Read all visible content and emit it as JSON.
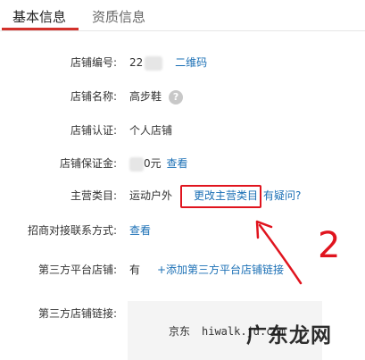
{
  "tabs": [
    {
      "label": "基本信息",
      "active": true
    },
    {
      "label": "资质信息",
      "active": false
    }
  ],
  "store": {
    "id_label": "店铺编号:",
    "id_prefix": "22",
    "qrcode_link": "二维码",
    "name_label": "店铺名称:",
    "name_value": "高步鞋",
    "cert_label": "店铺认证:",
    "cert_value": "个人店铺",
    "deposit_label": "店铺保证金:",
    "deposit_suffix": "0元",
    "deposit_view": "查看",
    "category_label": "主营类目:",
    "category_value": "运动户外",
    "change_category": "更改主营类目",
    "question_link": "有疑问?",
    "contact_label": "招商对接联系方式:",
    "contact_view": "查看",
    "third_platform_label": "第三方平台店铺:",
    "third_platform_value": "有",
    "add_third_platform": "+添加第三方平台店铺链接",
    "third_link_label": "第三方店铺链接:",
    "third_link_platform": "京东",
    "third_link_url": "hiwalk.jd.com"
  },
  "annotation": {
    "number": "2"
  },
  "watermark": "广东龙网",
  "colors": {
    "accent_red": "#d3312b",
    "link_blue": "#1a6fb5",
    "annotation_red": "#e0141e"
  }
}
